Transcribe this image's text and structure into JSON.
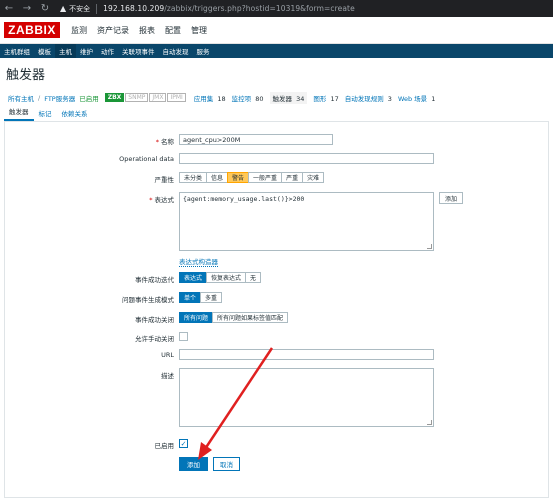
{
  "browser": {
    "insecure_label": "不安全",
    "url_host": "192.168.10.209",
    "url_path": "/zabbix/triggers.php?hostid=10319&form=create"
  },
  "header": {
    "logo": "ZABBIX",
    "menu": [
      "监测",
      "资产记录",
      "报表",
      "配置",
      "管理"
    ]
  },
  "submenu": [
    "主机群组",
    "模板",
    "主机",
    "维护",
    "动作",
    "关联项事件",
    "自动发现",
    "服务"
  ],
  "page_title": "触发器",
  "crumbs": {
    "all_hosts": "所有主机",
    "host": "FTP服务器",
    "status": "已启用",
    "tags": [
      "ZBX",
      "SNMP",
      "JMX",
      "IPMI"
    ],
    "items": [
      {
        "label": "应用集",
        "count": "18"
      },
      {
        "label": "监控项",
        "count": "80"
      },
      {
        "label": "触发器",
        "count": "34"
      },
      {
        "label": "图形",
        "count": "17"
      },
      {
        "label": "自动发现规则",
        "count": "3"
      },
      {
        "label": "Web 场景",
        "count": "1"
      }
    ]
  },
  "form_tabs": [
    "触发器",
    "标记",
    "依赖关系"
  ],
  "form": {
    "name_label": "名称",
    "name_value": "agent_cpu>200M",
    "opdata_label": "Operational data",
    "opdata_value": "",
    "severity_label": "严重性",
    "severity_options": [
      "未分类",
      "信息",
      "警告",
      "一般严重",
      "严重",
      "灾难"
    ],
    "severity_selected": "警告",
    "expression_label": "表达式",
    "expression_value": "{agent:memory_usage.last()}>200",
    "add_expr_button": "添加",
    "expr_builder_link": "表达式构造器",
    "ok_event_label": "事件成功迭代",
    "ok_event_options": [
      "表达式",
      "恢复表达式",
      "无"
    ],
    "problem_mode_label": "问题事件生成模式",
    "problem_mode_options": [
      "单个",
      "多重"
    ],
    "ok_close_label": "事件成功关闭",
    "ok_close_options": [
      "所有问题",
      "所有问题如果标签值匹配"
    ],
    "manual_close_label": "允许手动关闭",
    "url_label": "URL",
    "url_value": "",
    "desc_label": "描述",
    "desc_value": "",
    "enabled_label": "已启用",
    "submit_button": "添加",
    "cancel_button": "取消"
  },
  "colors": {
    "zabbix_red": "#d40000",
    "nav_blue": "#0a466a",
    "accent_blue": "#0275b8",
    "warning_yellow": "#ffc859",
    "enabled_green": "#1a9637",
    "annotation_arrow": "#e02020"
  }
}
